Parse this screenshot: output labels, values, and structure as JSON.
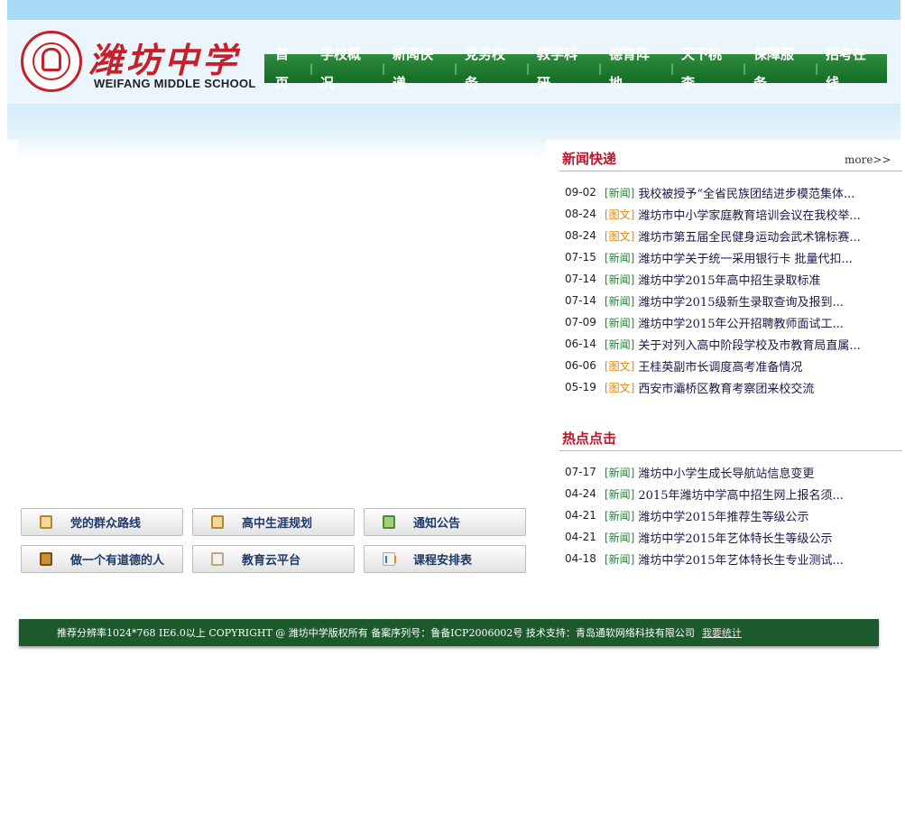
{
  "site": {
    "name_cn": "潍坊中学",
    "name_en": "WEIFANG MIDDLE SCHOOL"
  },
  "nav": {
    "items": [
      "首页",
      "学校概况",
      "新闻快递",
      "党务校务",
      "教学科研",
      "德育阵地",
      "天下桃李",
      "保障服务",
      "招考在线"
    ]
  },
  "buttons": [
    {
      "label": "党的群众路线",
      "icon": "clipboard-icon"
    },
    {
      "label": "高中生涯规划",
      "icon": "clipboard-icon"
    },
    {
      "label": "通知公告",
      "icon": "notice-icon"
    },
    {
      "label": "做一个有道德的人",
      "icon": "book-icon"
    },
    {
      "label": "教育云平台",
      "icon": "window-icon"
    },
    {
      "label": "课程安排表",
      "icon": "chart-icon"
    }
  ],
  "news": {
    "title": "新闻快递",
    "more": "more>>",
    "items": [
      {
        "date": "09-02",
        "tag": "[新闻]",
        "title": "我校被授予“全省民族团结进步模范集体..."
      },
      {
        "date": "08-24",
        "tag": "[图文]",
        "title": "潍坊市中小学家庭教育培训会议在我校举..."
      },
      {
        "date": "08-24",
        "tag": "[图文]",
        "title": "潍坊市第五届全民健身运动会武术锦标赛..."
      },
      {
        "date": "07-15",
        "tag": "[新闻]",
        "title": "潍坊中学关于统一采用银行卡 批量代扣..."
      },
      {
        "date": "07-14",
        "tag": "[新闻]",
        "title": "潍坊中学2015年高中招生录取标准"
      },
      {
        "date": "07-14",
        "tag": "[新闻]",
        "title": "潍坊中学2015级新生录取查询及报到..."
      },
      {
        "date": "07-09",
        "tag": "[新闻]",
        "title": "潍坊中学2015年公开招聘教师面试工..."
      },
      {
        "date": "06-14",
        "tag": "[新闻]",
        "title": "关于对列入高中阶段学校及市教育局直属..."
      },
      {
        "date": "06-06",
        "tag": "[图文]",
        "title": "王桂英副市长调度高考准备情况"
      },
      {
        "date": "05-19",
        "tag": "[图文]",
        "title": "西安市灞桥区教育考察团来校交流"
      }
    ]
  },
  "hot": {
    "title": "热点点击",
    "items": [
      {
        "date": "07-17",
        "tag": "[新闻]",
        "title": "潍坊中小学生成长导航站信息变更"
      },
      {
        "date": "04-24",
        "tag": "[新闻]",
        "title": "2015年潍坊中学高中招生网上报名须..."
      },
      {
        "date": "04-21",
        "tag": "[新闻]",
        "title": "潍坊中学2015年推荐生等级公示"
      },
      {
        "date": "04-21",
        "tag": "[新闻]",
        "title": "潍坊中学2015年艺体特长生等级公示"
      },
      {
        "date": "04-18",
        "tag": "[新闻]",
        "title": "潍坊中学2015年艺体特长生专业测试..."
      }
    ]
  },
  "footer": {
    "text": "推荐分辨率1024*768 IE6.0以上 COPYRIGHT @ 潍坊中学版权所有 备案序列号：鲁备ICP2006002号 技术支持：青岛通软网络科技有限公司",
    "stat": "我要统计"
  },
  "colors": {
    "nav_green": "#146b25",
    "title_red": "#c0142a",
    "tag_news": "#2b7f3b",
    "tag_pic": "#e08a12",
    "footer_green": "#1c5a2b"
  }
}
